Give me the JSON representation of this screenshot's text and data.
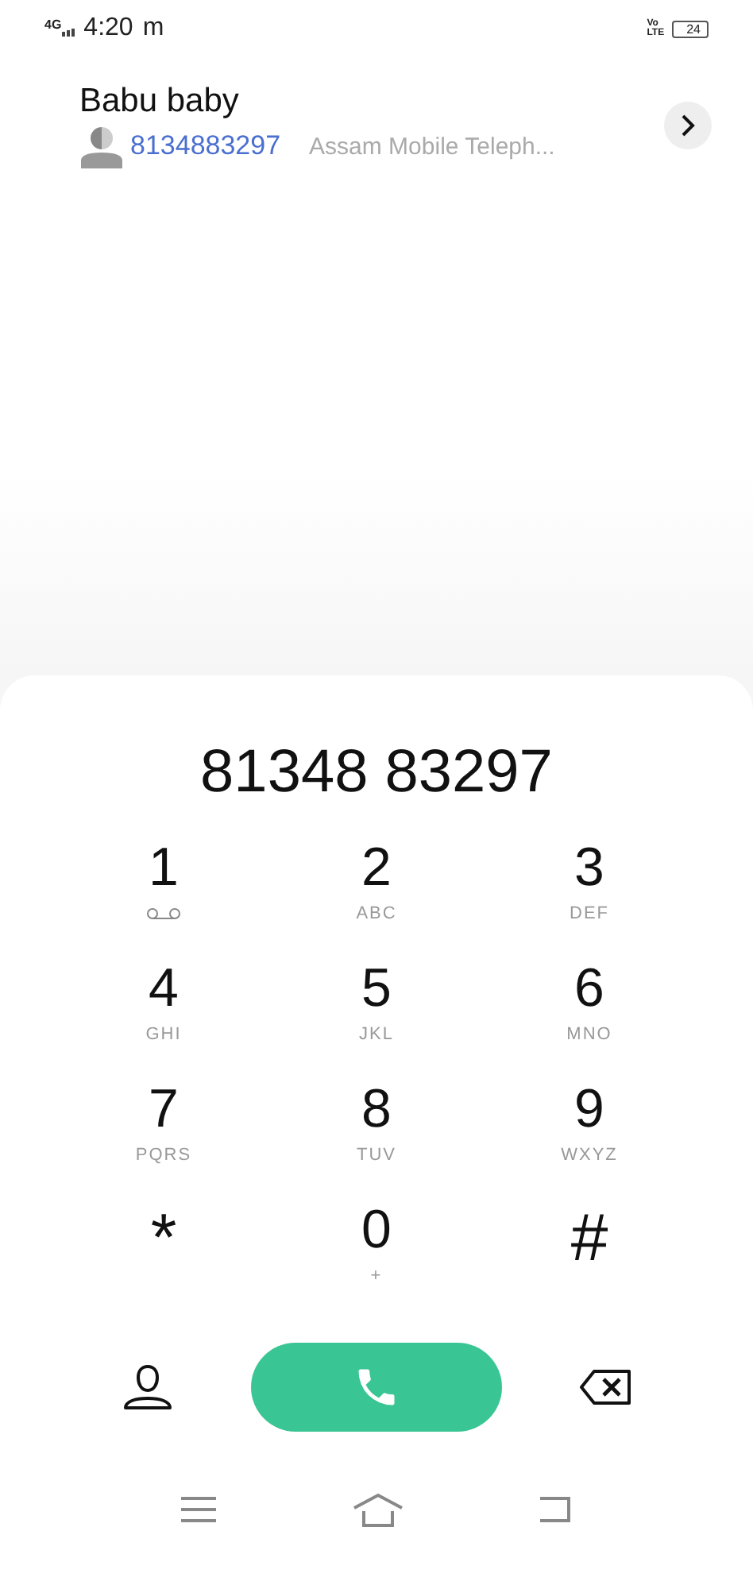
{
  "status_bar": {
    "network": "4G",
    "time": "4:20",
    "time_suffix": "m",
    "volte": "Vo\nLTE",
    "battery": "24"
  },
  "suggestion": {
    "name": "Babu baby",
    "number": "8134883297",
    "carrier": "Assam Mobile Teleph..."
  },
  "dialed_number": "81348 83297",
  "keys": [
    {
      "digit": "1",
      "kind": "voicemail"
    },
    {
      "digit": "2",
      "kind": "letters",
      "letters": "ABC"
    },
    {
      "digit": "3",
      "kind": "letters",
      "letters": "DEF"
    },
    {
      "digit": "4",
      "kind": "letters",
      "letters": "GHI"
    },
    {
      "digit": "5",
      "kind": "letters",
      "letters": "JKL"
    },
    {
      "digit": "6",
      "kind": "letters",
      "letters": "MNO"
    },
    {
      "digit": "7",
      "kind": "letters",
      "letters": "PQRS"
    },
    {
      "digit": "8",
      "kind": "letters",
      "letters": "TUV"
    },
    {
      "digit": "9",
      "kind": "letters",
      "letters": "WXYZ"
    },
    {
      "digit": "*",
      "kind": "plain"
    },
    {
      "digit": "0",
      "kind": "letters",
      "letters": "+"
    },
    {
      "digit": "#",
      "kind": "plain"
    }
  ]
}
